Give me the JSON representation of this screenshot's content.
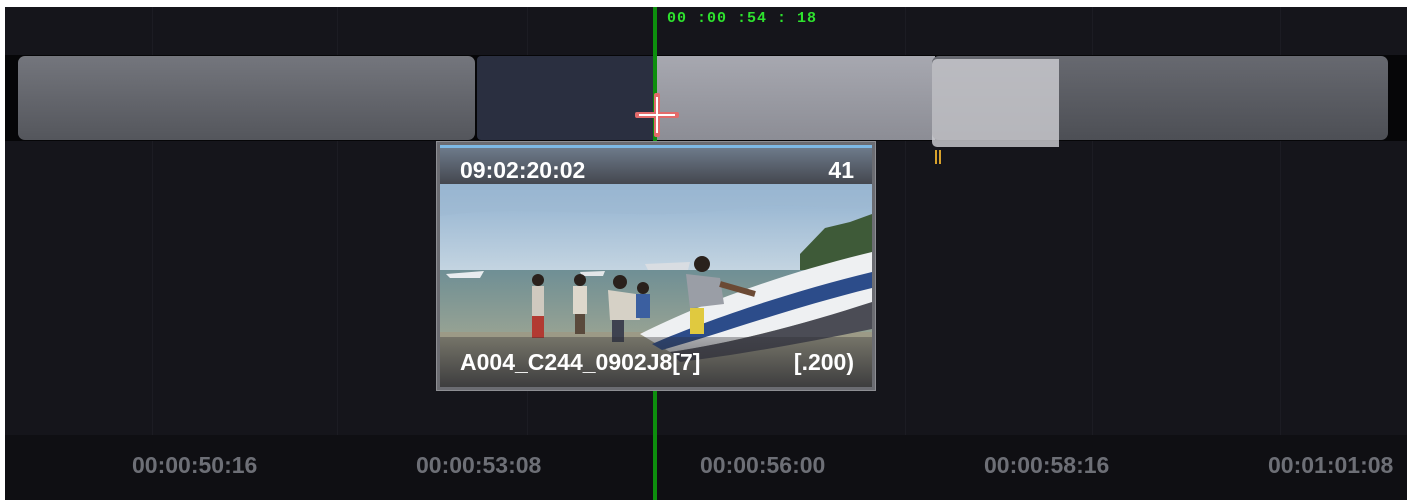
{
  "playhead": {
    "timecode": "00 :00 :54 : 18"
  },
  "preview": {
    "source_timecode": "09:02:20:02",
    "frame_count": "41",
    "clip_name": "A004_C244_0902J8[7]",
    "speed": "[.200)"
  },
  "ruler": {
    "labels": [
      "00:00:50:16",
      "00:00:53:08",
      "00:00:56:00",
      "00:00:58:16",
      "00:01:01:08"
    ]
  },
  "colors": {
    "background": "#15151b",
    "playhead": "#0d8f0d",
    "playhead_text": "#2ee12e",
    "marker": "#d7a12c",
    "ruler_text": "#6d6f76"
  },
  "icons": {
    "cursor": "crosshair-cursor-icon",
    "marker": "in-out-marker-icon"
  }
}
